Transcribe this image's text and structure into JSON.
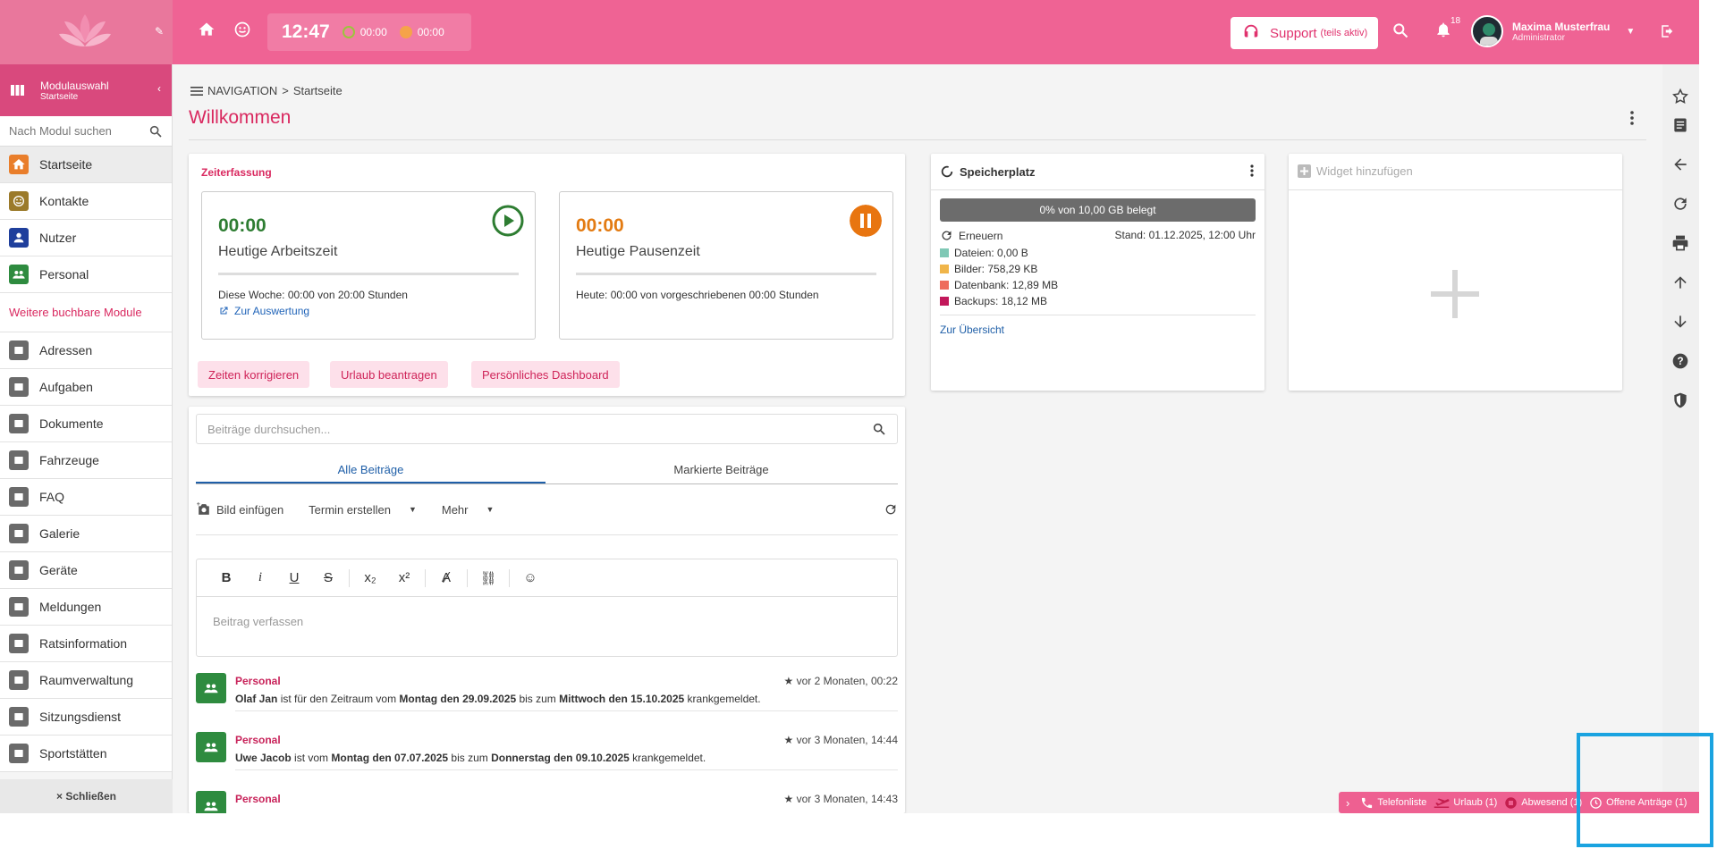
{
  "topbar": {
    "clock": "12:47",
    "work_timer": "00:00",
    "pause_timer": "00:00",
    "support_label": "Support",
    "support_note": "(teils aktiv)",
    "notification_count": "18",
    "user_name": "Maxima Musterfrau",
    "user_role": "Administrator"
  },
  "sidebar": {
    "module_title": "Modulauswahl",
    "module_sub": "Startseite",
    "search_placeholder": "Nach Modul suchen",
    "items_top": [
      {
        "label": "Startseite",
        "color": "#e97e2b",
        "icon": "home-icon"
      },
      {
        "label": "Kontakte",
        "color": "#9b7a2a",
        "icon": "smiley-icon"
      },
      {
        "label": "Nutzer",
        "color": "#1f3f9c",
        "icon": "user-icon"
      },
      {
        "label": "Personal",
        "color": "#2e8b3f",
        "icon": "people-icon"
      }
    ],
    "more_label": "Weitere buchbare Module",
    "items_more": [
      {
        "label": "Adressen",
        "icon": "address-icon"
      },
      {
        "label": "Aufgaben",
        "icon": "task-icon"
      },
      {
        "label": "Dokumente",
        "icon": "folder-icon"
      },
      {
        "label": "Fahrzeuge",
        "icon": "car-icon"
      },
      {
        "label": "FAQ",
        "icon": "help-icon"
      },
      {
        "label": "Galerie",
        "icon": "camera-icon"
      },
      {
        "label": "Geräte",
        "icon": "device-icon"
      },
      {
        "label": "Meldungen",
        "icon": "alert-icon"
      },
      {
        "label": "Ratsinformation",
        "icon": "institution-icon"
      },
      {
        "label": "Raumverwaltung",
        "icon": "location-icon"
      },
      {
        "label": "Sitzungsdienst",
        "icon": "meeting-icon"
      },
      {
        "label": "Sportstätten",
        "icon": "arrows-icon"
      }
    ],
    "close_label": "× Schließen"
  },
  "main": {
    "breadcrumb_nav": "NAVIGATION",
    "breadcrumb_sep": ">",
    "breadcrumb_current": "Startseite",
    "title": "Willkommen"
  },
  "zeiterfassung": {
    "title": "Zeiterfassung",
    "work": {
      "time": "00:00",
      "label": "Heutige Arbeitszeit",
      "line1": "Diese Woche: 00:00 von 20:00 Stunden",
      "link": "Zur Auswertung"
    },
    "pause": {
      "time": "00:00",
      "label": "Heutige Pausenzeit",
      "line1": "Heute: 00:00 von vorgeschriebenen 00:00 Stunden"
    },
    "buttons": [
      "Zeiten korrigieren",
      "Urlaub beantragen",
      "Persönliches Dashboard"
    ]
  },
  "feed": {
    "search_placeholder": "Beiträge durchsuchen...",
    "tabs": [
      "Alle Beiträge",
      "Markierte Beiträge"
    ],
    "toolbar": {
      "image": "Bild einfügen",
      "event": "Termin erstellen",
      "more": "Mehr"
    },
    "editor_placeholder": "Beitrag verfassen",
    "posts": [
      {
        "category": "Personal",
        "when": "vor 2 Monaten, 00:22",
        "name": "Olaf Jan",
        "t1": " ist für den Zeitraum vom ",
        "d1": "Montag den 29.09.2025",
        "t2": " bis zum ",
        "d2": "Mittwoch den 15.10.2025",
        "t3": " krankgemeldet."
      },
      {
        "category": "Personal",
        "when": "vor 3 Monaten, 14:44",
        "name": "Uwe Jacob",
        "t1": " ist vom ",
        "d1": "Montag den 07.07.2025",
        "t2": " bis zum ",
        "d2": "Donnerstag den 09.10.2025",
        "t3": " krankgemeldet."
      },
      {
        "category": "Personal",
        "when": "vor 3 Monaten, 14:43",
        "name": "",
        "t1": "",
        "d1": "",
        "t2": "",
        "d2": "",
        "t3": ""
      }
    ]
  },
  "storage": {
    "title": "Speicherplatz",
    "usage_fraction": 0.0,
    "usage_text": "0% von 10,00 GB belegt",
    "renew": "Erneuern",
    "stand": "Stand: 01.12.2025, 12:00 Uhr",
    "legend": [
      {
        "label": "Dateien: 0,00 B",
        "color": "#7fc8b5"
      },
      {
        "label": "Bilder: 758,29 KB",
        "color": "#f0b54a"
      },
      {
        "label": "Datenbank: 12,89 MB",
        "color": "#ee6c5c"
      },
      {
        "label": "Backups: 18,12 MB",
        "color": "#c2185b"
      }
    ],
    "link": "Zur Übersicht"
  },
  "widget": {
    "title": "Widget hinzufügen"
  },
  "statusbar": {
    "phone": "Telefonliste",
    "vacation": "Urlaub (1)",
    "absent": "Abwesend (1)",
    "requests": "Offene Anträge (1)"
  }
}
